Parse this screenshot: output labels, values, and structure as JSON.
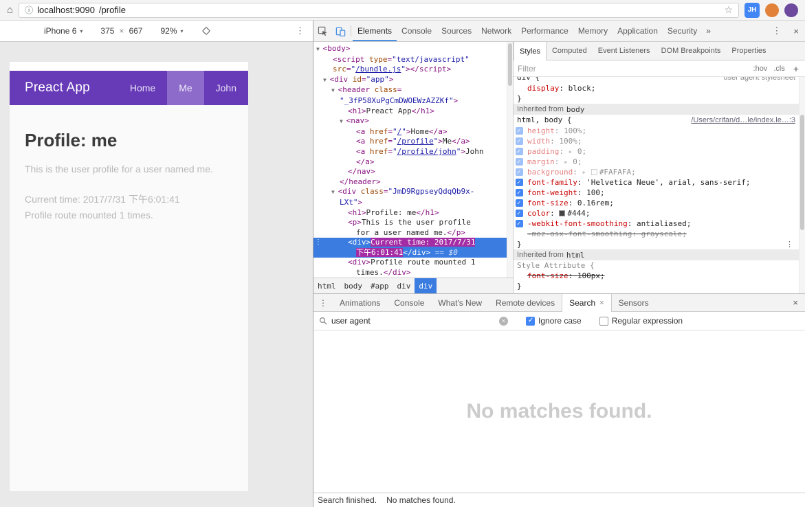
{
  "colors": {
    "accent_blue": "#4285f4",
    "selection_blue": "#3b7ce0",
    "preact_purple": "#673ab8",
    "highlight_magenta": "#a42ca4"
  },
  "icons": {
    "home": "⌂",
    "info": "ⓘ",
    "star": "☆",
    "menu": "⋮",
    "close": "×",
    "caret": "▾",
    "more_tabs": "»",
    "expand": "▸ ",
    "clear": "×"
  },
  "browser": {
    "url_host": "localhost:9090",
    "url_path": "/profile",
    "avatar_label": "JH"
  },
  "device_toolbar": {
    "device": "iPhone 6",
    "width": "375",
    "times": "×",
    "height": "667",
    "zoom": "92%"
  },
  "phone": {
    "title": "Preact App",
    "nav": [
      {
        "label": "Home",
        "active": false
      },
      {
        "label": "Me",
        "active": true
      },
      {
        "label": "John",
        "active": false
      }
    ],
    "heading": "Profile: me",
    "paragraph": "This is the user profile for a user named me.",
    "line_time": "Current time: 2017/7/31 下午6:01:41",
    "line_mounted": "Profile route mounted 1 times."
  },
  "devtools": {
    "main_tabs": [
      {
        "label": "Elements",
        "selected": true
      },
      {
        "label": "Console"
      },
      {
        "label": "Sources"
      },
      {
        "label": "Network"
      },
      {
        "label": "Performance"
      },
      {
        "label": "Memory"
      },
      {
        "label": "Application"
      },
      {
        "label": "Security"
      }
    ]
  },
  "dom_tree": {
    "lines": [
      {
        "pad": 4,
        "tokens": [
          [
            "ar",
            "▼ "
          ],
          [
            "t",
            "<body>"
          ]
        ]
      },
      {
        "pad": 28,
        "tokens": [
          [
            "t",
            "<script "
          ],
          [
            "a",
            "type"
          ],
          [
            "t",
            "="
          ],
          [
            "v",
            "\"text/javascript\""
          ]
        ]
      },
      {
        "pad": 28,
        "tokens": [
          [
            "a",
            "src"
          ],
          [
            "t",
            "="
          ],
          [
            "v",
            "\""
          ],
          [
            "l",
            "/bundle.js"
          ],
          [
            "v",
            "\""
          ],
          [
            "t",
            "></script>"
          ]
        ]
      },
      {
        "pad": 14,
        "tokens": [
          [
            "ar",
            "▼ "
          ],
          [
            "t",
            "<div "
          ],
          [
            "a",
            "id"
          ],
          [
            "t",
            "="
          ],
          [
            "v",
            "\"app\""
          ],
          [
            "t",
            ">"
          ]
        ]
      },
      {
        "pad": 26,
        "tokens": [
          [
            "ar",
            "▼ "
          ],
          [
            "t",
            "<header "
          ],
          [
            "a",
            "class"
          ],
          [
            "t",
            "="
          ]
        ]
      },
      {
        "pad": 38,
        "tokens": [
          [
            "v",
            "\"_3fP58XuPgCmDWOEWzAZZKf\""
          ],
          [
            "t",
            ">"
          ]
        ]
      },
      {
        "pad": 50,
        "tokens": [
          [
            "t",
            "<h1>"
          ],
          [
            "x",
            "Preact App"
          ],
          [
            "t",
            "</h1>"
          ]
        ]
      },
      {
        "pad": 38,
        "tokens": [
          [
            "ar",
            "▼ "
          ],
          [
            "t",
            "<nav>"
          ]
        ]
      },
      {
        "pad": 62,
        "tokens": [
          [
            "t",
            "<a "
          ],
          [
            "a",
            "href"
          ],
          [
            "t",
            "="
          ],
          [
            "v",
            "\""
          ],
          [
            "l",
            "/"
          ],
          [
            "v",
            "\""
          ],
          [
            "t",
            ">"
          ],
          [
            "x",
            "Home"
          ],
          [
            "t",
            "</a>"
          ]
        ]
      },
      {
        "pad": 62,
        "tokens": [
          [
            "t",
            "<a "
          ],
          [
            "a",
            "href"
          ],
          [
            "t",
            "="
          ],
          [
            "v",
            "\""
          ],
          [
            "l",
            "/profile"
          ],
          [
            "v",
            "\""
          ],
          [
            "t",
            ">"
          ],
          [
            "x",
            "Me"
          ],
          [
            "t",
            "</a>"
          ]
        ]
      },
      {
        "pad": 62,
        "tokens": [
          [
            "t",
            "<a "
          ],
          [
            "a",
            "href"
          ],
          [
            "t",
            "="
          ],
          [
            "v",
            "\""
          ],
          [
            "l",
            "/profile/john"
          ],
          [
            "v",
            "\""
          ],
          [
            "t",
            ">"
          ],
          [
            "x",
            "John"
          ]
        ]
      },
      {
        "pad": 62,
        "tokens": [
          [
            "t",
            "</a>"
          ]
        ]
      },
      {
        "pad": 50,
        "tokens": [
          [
            "t",
            "</nav>"
          ]
        ]
      },
      {
        "pad": 38,
        "tokens": [
          [
            "t",
            "</header>"
          ]
        ]
      },
      {
        "pad": 26,
        "tokens": [
          [
            "ar",
            "▼ "
          ],
          [
            "t",
            "<div "
          ],
          [
            "a",
            "class"
          ],
          [
            "t",
            "="
          ],
          [
            "v",
            "\"JmD9RgpseyQdqQb9x-"
          ]
        ]
      },
      {
        "pad": 38,
        "tokens": [
          [
            "v",
            "LXt\""
          ],
          [
            "t",
            ">"
          ]
        ]
      },
      {
        "pad": 50,
        "tokens": [
          [
            "t",
            "<h1>"
          ],
          [
            "x",
            "Profile: me"
          ],
          [
            "t",
            "</h1>"
          ]
        ]
      },
      {
        "pad": 50,
        "tokens": [
          [
            "t",
            "<p>"
          ],
          [
            "x",
            "This is the user profile"
          ]
        ]
      },
      {
        "pad": 62,
        "tokens": [
          [
            "x",
            "for a user named me."
          ],
          [
            "t",
            "</p>"
          ]
        ]
      },
      {
        "pad": 50,
        "sel": true,
        "more": true,
        "tokens": [
          [
            "t",
            "<div>"
          ],
          [
            "hl",
            "Current time: 2017/7/31"
          ]
        ]
      },
      {
        "pad": 62,
        "sel": true,
        "tokens": [
          [
            "hl",
            "下午6:01:41"
          ],
          [
            "t",
            "</div>"
          ],
          [
            "eq",
            " == $0"
          ]
        ]
      },
      {
        "pad": 50,
        "tokens": [
          [
            "t",
            "<div>"
          ],
          [
            "x",
            "Profile route mounted 1"
          ]
        ]
      },
      {
        "pad": 62,
        "tokens": [
          [
            "x",
            "times."
          ],
          [
            "t",
            "</div>"
          ]
        ]
      }
    ]
  },
  "breadcrumb": {
    "items": [
      {
        "label": "html"
      },
      {
        "label": "body"
      },
      {
        "label": "#app"
      },
      {
        "label": "div"
      },
      {
        "label": "div",
        "selected": true
      }
    ]
  },
  "styles_panel": {
    "tabs": [
      {
        "label": "Styles",
        "selected": true
      },
      {
        "label": "Computed"
      },
      {
        "label": "Event Listeners"
      },
      {
        "label": "DOM Breakpoints"
      },
      {
        "label": "Properties"
      }
    ],
    "filter_placeholder": "Filter",
    "hov": ":hov",
    "cls": ".cls",
    "plus": "+",
    "rows": [
      {
        "type": "selector",
        "text": "div {",
        "origin": "user agent stylesheet",
        "clip": true
      },
      {
        "type": "prop",
        "name": "display",
        "value": "block"
      },
      {
        "type": "close"
      },
      {
        "type": "section",
        "label": "Inherited from",
        "node": "body"
      },
      {
        "type": "selector",
        "text": "html, body {",
        "origin": "/Users/crifan/d…le/index.le…:3",
        "origin_link": true
      },
      {
        "type": "prop",
        "chk": true,
        "faded": true,
        "name": "height",
        "value": "100%"
      },
      {
        "type": "prop",
        "chk": true,
        "faded": true,
        "name": "width",
        "value": "100%"
      },
      {
        "type": "prop",
        "chk": true,
        "faded": true,
        "name": "padding",
        "value": "0",
        "expand": true
      },
      {
        "type": "prop",
        "chk": true,
        "faded": true,
        "name": "margin",
        "value": "0",
        "expand": true
      },
      {
        "type": "prop",
        "chk": true,
        "faded": true,
        "name": "background",
        "value": "#FAFAFA",
        "expand": true,
        "swatch": "#FAFAFA"
      },
      {
        "type": "prop",
        "chk": true,
        "name": "font-family",
        "value": "'Helvetica Neue', arial, sans-serif"
      },
      {
        "type": "prop",
        "chk": true,
        "name": "font-weight",
        "value": "100"
      },
      {
        "type": "prop",
        "chk": true,
        "name": "font-size",
        "value": "0.16rem"
      },
      {
        "type": "prop",
        "chk": true,
        "name": "color",
        "value": "#444",
        "swatch": "#444444"
      },
      {
        "type": "prop",
        "chk": true,
        "name": "-webkit-font-smoothing",
        "value": "antialiased"
      },
      {
        "type": "prop",
        "struck": true,
        "gray": true,
        "name": "-moz-osx-font-smoothing",
        "value": "grayscale"
      },
      {
        "type": "close",
        "more": true
      },
      {
        "type": "section",
        "label": "Inherited from",
        "node": "html"
      },
      {
        "type": "selector",
        "text": "Style Attribute {",
        "gray": true
      },
      {
        "type": "prop",
        "struck": true,
        "name": "font-size",
        "value": "100px"
      },
      {
        "type": "close"
      }
    ]
  },
  "drawer": {
    "tabs": [
      {
        "label": "Animations"
      },
      {
        "label": "Console"
      },
      {
        "label": "What's New"
      },
      {
        "label": "Remote devices"
      },
      {
        "label": "Search",
        "selected": true,
        "closable": true
      },
      {
        "label": "Sensors"
      }
    ],
    "search": {
      "query": "user agent",
      "ignore_case_label": "Ignore case",
      "ignore_case_checked": true,
      "regex_label": "Regular expression",
      "regex_checked": false
    },
    "empty_message": "No matches found.",
    "status_left": "Search finished.",
    "status_right": "No matches found."
  }
}
